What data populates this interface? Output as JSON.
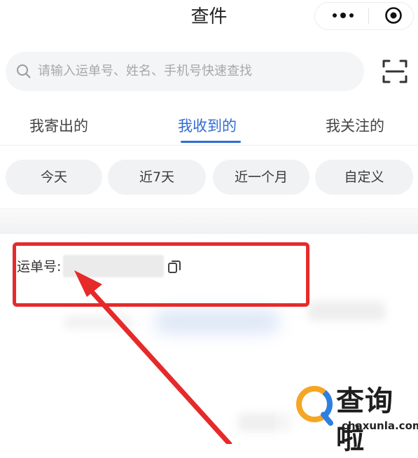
{
  "header": {
    "title": "查件"
  },
  "search": {
    "placeholder": "请输入运单号、姓名、手机号快速查找"
  },
  "tabs": [
    {
      "label": "我寄出的",
      "active": false
    },
    {
      "label": "我收到的",
      "active": true
    },
    {
      "label": "我关注的",
      "active": false
    }
  ],
  "filters": [
    {
      "label": "今天"
    },
    {
      "label": "近7天"
    },
    {
      "label": "近一个月"
    },
    {
      "label": "自定义"
    }
  ],
  "card": {
    "waybill_label": "运单号:"
  },
  "watermark": {
    "name": "查询啦",
    "url": "chaxunla.com"
  },
  "colors": {
    "accent": "#2f6cd6",
    "highlight": "#e62a2a",
    "watermark_orange": "#f5a623",
    "watermark_blue": "#2f7fe0"
  },
  "icons": [
    "more-icon",
    "close-icon",
    "search-icon",
    "scan-icon",
    "copy-icon"
  ]
}
